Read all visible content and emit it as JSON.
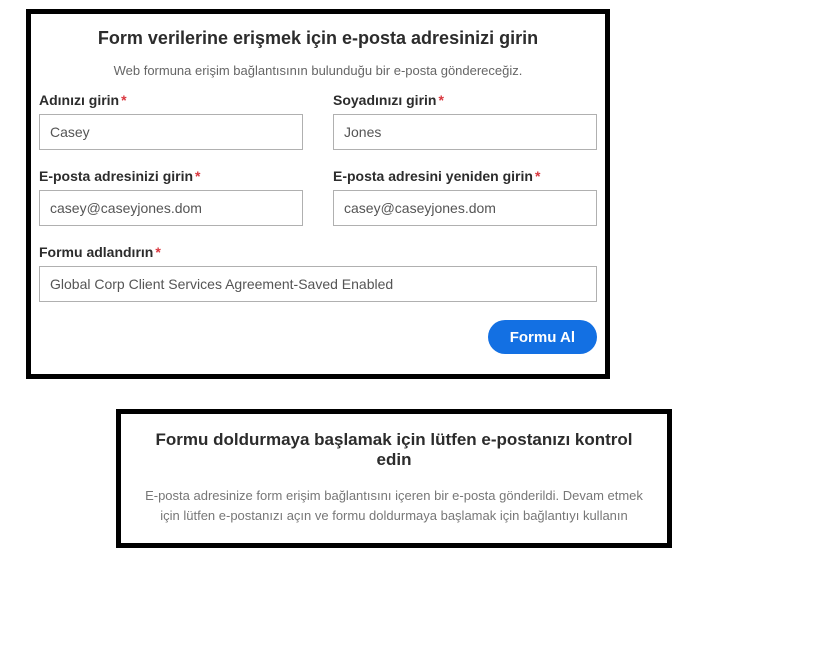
{
  "panel1": {
    "title": "Form verilerine erişmek için e-posta adresinizi girin",
    "subtitle": "Web formuna erişim bağlantısının bulunduğu bir e-posta göndereceğiz.",
    "first_name": {
      "label": "Adınızı girin",
      "value": "Casey"
    },
    "last_name": {
      "label": "Soyadınızı girin",
      "value": "Jones"
    },
    "email": {
      "label": "E-posta adresinizi girin",
      "value": "casey@caseyjones.dom"
    },
    "email_confirm": {
      "label": "E-posta adresini yeniden girin",
      "value": "casey@caseyjones.dom"
    },
    "form_name": {
      "label": "Formu adlandırın",
      "value": "Global Corp Client Services Agreement-Saved Enabled"
    },
    "submit_label": "Formu Al",
    "required_mark": "*"
  },
  "panel2": {
    "title": "Formu doldurmaya başlamak için lütfen e-postanızı kontrol edin",
    "body": "E-posta adresinize form erişim bağlantısını içeren bir e-posta gönderildi. Devam etmek için lütfen e-postanızı açın ve formu doldurmaya başlamak için bağlantıyı kullanın"
  }
}
